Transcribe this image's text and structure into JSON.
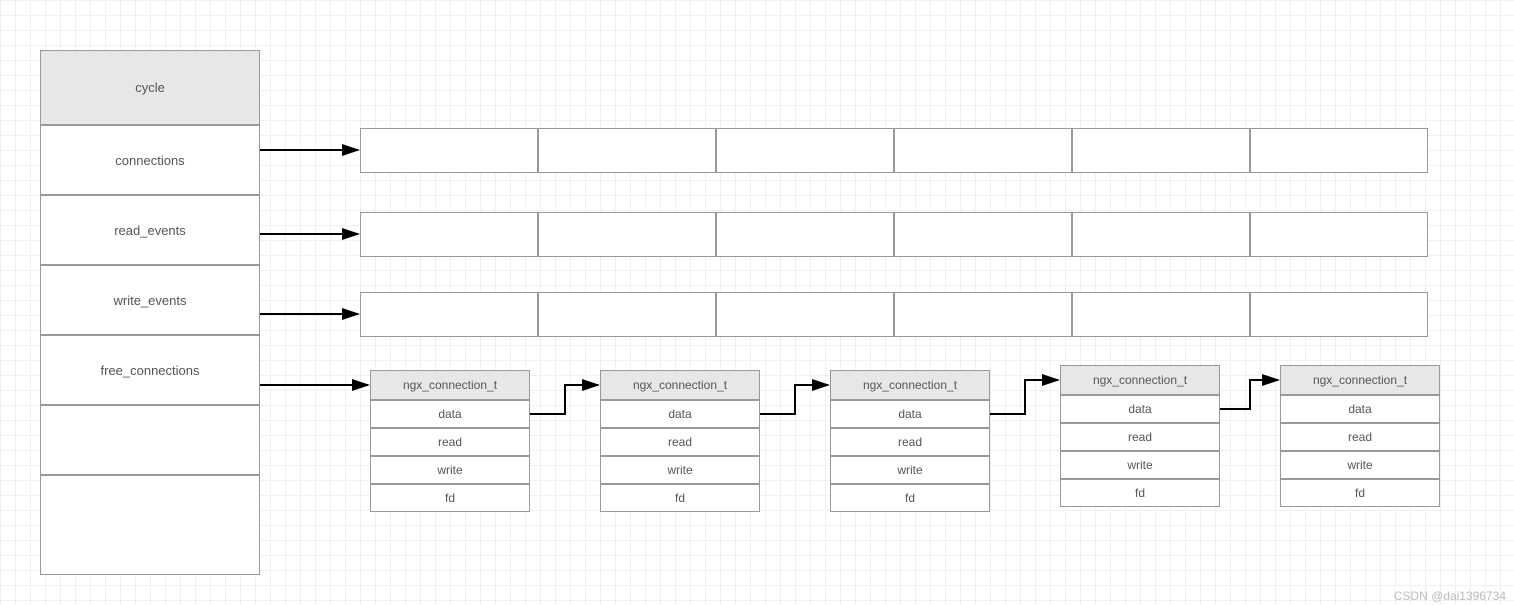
{
  "cycle": {
    "title": "cycle",
    "rows": [
      "connections",
      "read_events",
      "write_events",
      "free_connections",
      "",
      ""
    ]
  },
  "arrays": {
    "cells_per_row": 6
  },
  "struct": {
    "title": "ngx_connection_t",
    "fields": [
      "data",
      "read",
      "write",
      "fd"
    ],
    "count": 5
  },
  "watermark": "CSDN @dai1396734"
}
